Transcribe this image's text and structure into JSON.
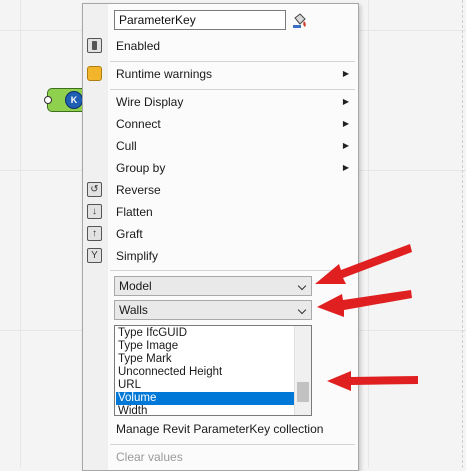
{
  "menu": {
    "name_value": "ParameterKey",
    "items": [
      {
        "label": "Enabled",
        "icon": "toggle-icon"
      },
      {
        "label": "Runtime warnings",
        "icon": "warning-icon",
        "submenu": true
      },
      {
        "label": "Wire Display",
        "submenu": true
      },
      {
        "label": "Connect",
        "submenu": true
      },
      {
        "label": "Cull",
        "submenu": true
      },
      {
        "label": "Group by",
        "submenu": true
      },
      {
        "label": "Reverse",
        "icon": "reverse-icon"
      },
      {
        "label": "Flatten",
        "icon": "flatten-icon"
      },
      {
        "label": "Graft",
        "icon": "graft-icon"
      },
      {
        "label": "Simplify",
        "icon": "simplify-icon"
      }
    ],
    "dropdowns": {
      "model": "Model",
      "category": "Walls"
    },
    "list": {
      "rows": [
        "Type IfcGUID",
        "Type Image",
        "Type Mark",
        "Unconnected Height",
        "URL",
        "Volume",
        "Width"
      ],
      "selected": "Volume"
    },
    "manage_label": "Manage Revit ParameterKey collection",
    "clear_label": "Clear values"
  },
  "component": {
    "badge": "K"
  },
  "colors": {
    "selection": "#0078d7",
    "annotation_arrow": "#e02020",
    "component_fill": "#8fd14f",
    "warning_icon": "#f3b52c"
  }
}
